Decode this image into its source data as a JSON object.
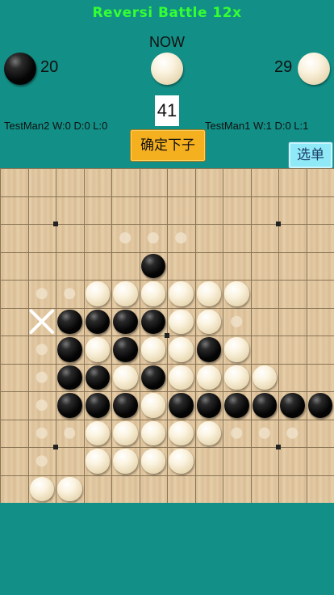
{
  "header": {
    "title": "Reversi Battle 12x",
    "now_label": "NOW"
  },
  "players": {
    "left": {
      "stone": "black",
      "count": "20",
      "stats": "TestMan2  W:0  D:0  L:0"
    },
    "right": {
      "stone": "white",
      "count": "29",
      "stats": "TestMan1  W:1  D:0  L:1"
    },
    "current_turn_stone": "white"
  },
  "move_number": "41",
  "buttons": {
    "confirm": "确定下子",
    "menu": "选单"
  },
  "board": {
    "size": 12,
    "cells": [
      "............",
      "............",
      "............",
      ".....B......",
      "...WWWWWW...",
      "..BBBBWW....",
      "..BWBWWBW...",
      "..BBWBWWWW..",
      "..BBBWBBBBBB",
      "...WWWWW....",
      "...WWWW.....",
      "..W........."
    ],
    "extra_white": [
      [
        11,
        1
      ]
    ],
    "hints": [
      [
        2,
        4
      ],
      [
        2,
        5
      ],
      [
        2,
        6
      ],
      [
        4,
        1
      ],
      [
        4,
        2
      ],
      [
        5,
        8
      ],
      [
        6,
        1
      ],
      [
        7,
        1
      ],
      [
        8,
        1
      ],
      [
        9,
        1
      ],
      [
        9,
        2
      ],
      [
        9,
        8
      ],
      [
        9,
        9
      ],
      [
        9,
        10
      ],
      [
        10,
        1
      ]
    ],
    "last_move_marker": {
      "row": 5,
      "col": 1,
      "symbol": "✕"
    },
    "star_points": [
      [
        2,
        2
      ],
      [
        2,
        10
      ],
      [
        10,
        2
      ],
      [
        10,
        10
      ],
      [
        6,
        6
      ]
    ],
    "colors": {
      "line": "#8a7556",
      "hint": "#f0e4cf",
      "background": "#128f86",
      "title": "#33ff33"
    }
  }
}
